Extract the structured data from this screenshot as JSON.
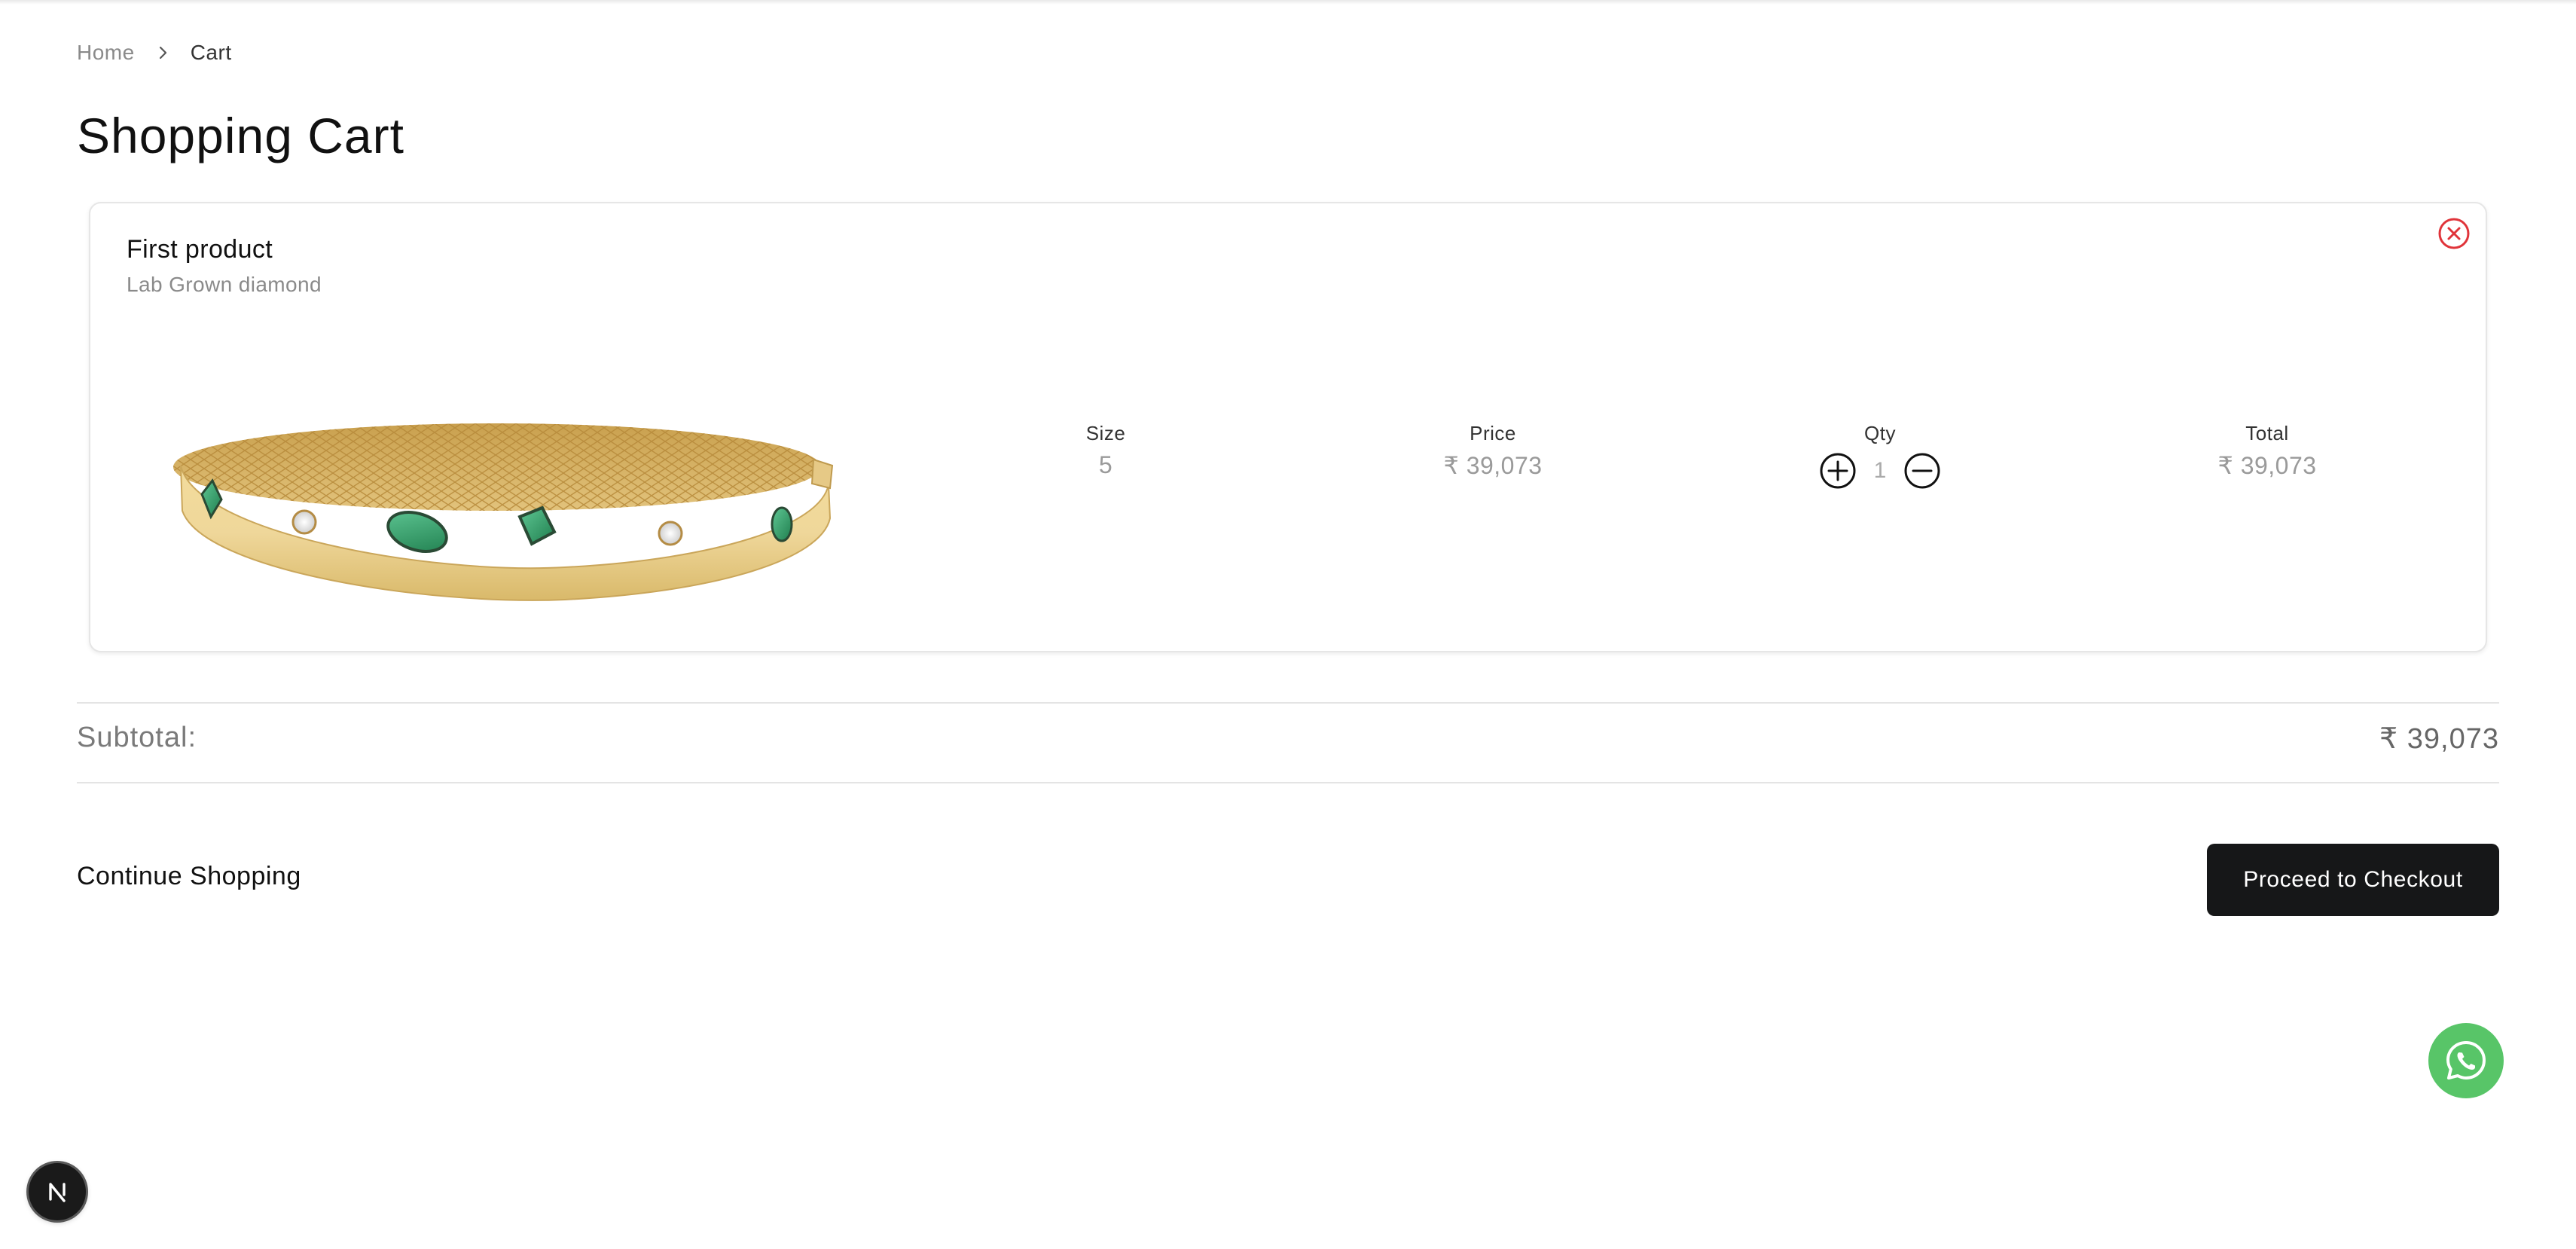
{
  "breadcrumb": {
    "home": "Home",
    "current": "Cart"
  },
  "page_title": "Shopping Cart",
  "cart_item": {
    "name": "First product",
    "subtitle": "Lab Grown diamond",
    "image_icon": "gold-bangle-with-emeralds-image",
    "size_label": "Size",
    "size_value": "5",
    "price_label": "Price",
    "price_value": "₹ 39,073",
    "qty_label": "Qty",
    "qty_value": "1",
    "total_label": "Total",
    "total_value": "₹ 39,073",
    "remove_icon": "close-circle-icon",
    "remove_color": "#e0343a"
  },
  "summary": {
    "subtotal_label": "Subtotal:",
    "subtotal_value": "₹ 39,073"
  },
  "actions": {
    "continue_label": "Continue Shopping",
    "checkout_label": "Proceed to Checkout"
  },
  "floating": {
    "whatsapp_icon": "whatsapp-icon",
    "whatsapp_color": "#58c568",
    "dev_badge_icon": "nextjs-logo-icon",
    "dev_badge_letter": "N"
  }
}
